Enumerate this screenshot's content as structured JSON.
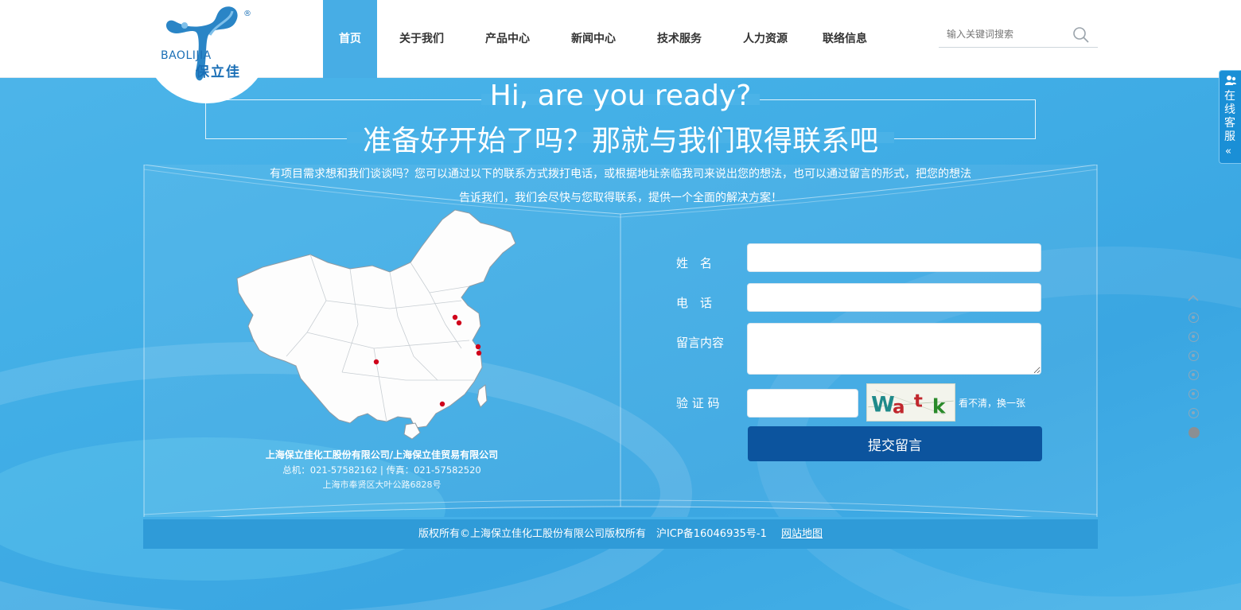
{
  "brand": {
    "logo_text": "BAOLIJIA",
    "logo_cn": "保立佳",
    "registered_mark": "®"
  },
  "nav": {
    "items": [
      {
        "label": "首页",
        "active": true
      },
      {
        "label": "关于我们"
      },
      {
        "label": "产品中心"
      },
      {
        "label": "新闻中心"
      },
      {
        "label": "技术服务"
      },
      {
        "label": "人力资源"
      },
      {
        "label": "联络信息"
      }
    ]
  },
  "search": {
    "placeholder": "输入关键词搜索",
    "icon": "search-icon"
  },
  "hero": {
    "title_en": "Hi, are you ready?",
    "title_cn": "准备好开始了吗？那就与我们取得联系吧",
    "description_line1": "有项目需求想和我们谈谈吗？您可以通过以下的联系方式拨打电话，或根据地址亲临我司来说出您的想法，也可以通过留言的形式，把您的想法",
    "description_line2": "告诉我们，我们会尽快与您取得联系，提供一个全面的解决方案！"
  },
  "company": {
    "name": "上海保立佳化工股份有限公司/上海保立佳贸易有限公司",
    "phones": "总机：021-57582162 | 传真：021-57582520",
    "address": "上海市奉贤区大叶公路6828号"
  },
  "form": {
    "name_label": "姓　名",
    "phone_label": "电　话",
    "message_label": "留言内容",
    "captcha_label": "验 证 码",
    "captcha_text": "Watk",
    "refresh_label": "看不清，换一张",
    "submit_label": "提交留言"
  },
  "footer": {
    "copyright": "版权所有©上海保立佳化工股份有限公司版权所有　沪ICP备16046935号-1",
    "sitemap_label": "网站地图"
  },
  "side": {
    "service_label": "在线客服",
    "collapse_icon": "«",
    "page_dots": 7,
    "active_dot": 7
  },
  "colors": {
    "accent": "#47ade5",
    "submit": "#0c549e",
    "map_dot": "#d0021b"
  }
}
